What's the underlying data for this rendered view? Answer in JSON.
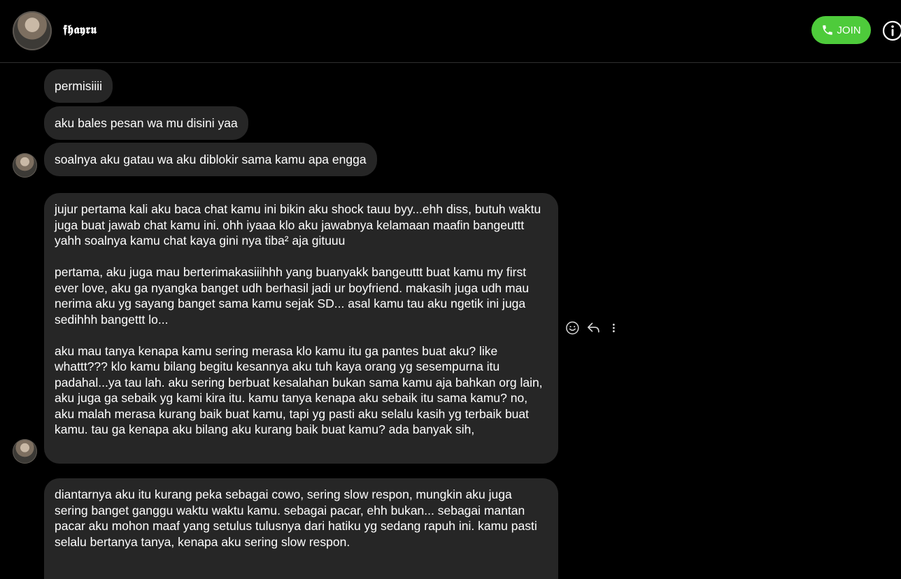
{
  "header": {
    "contact_name": "𝖋𝖍𝖆𝖞𝖗𝖚",
    "join_label": "JOIN"
  },
  "messages": [
    {
      "text": "permisiiii"
    },
    {
      "text": "aku bales pesan wa mu disini yaa"
    },
    {
      "text": "soalnya aku gatau wa aku diblokir sama kamu apa engga"
    },
    {
      "text": "jujur pertama kali aku baca chat kamu ini bikin aku shock tauu byy...ehh diss, butuh waktu juga buat jawab chat kamu ini. ohh iyaaa klo aku jawabnya kelamaan maafin bangeuttt yahh soalnya kamu chat kaya gini nya tiba² aja gituuu\n\npertama, aku juga mau berterimakasiiihhh yang buanyakk bangeuttt buat kamu my first ever love, aku ga nyangka banget udh berhasil jadi ur boyfriend. makasih juga udh mau nerima aku yg sayang banget sama kamu sejak SD... asal kamu tau aku ngetik ini juga sedihhh bangettt lo...\n\naku mau tanya kenapa kamu sering merasa klo kamu itu ga pantes buat aku? like whattt??? klo kamu bilang begitu kesannya aku tuh kaya orang yg sesempurna itu padahal...ya tau lah. aku sering berbuat kesalahan bukan sama kamu aja bahkan org lain, aku juga ga sebaik yg kami kira itu. kamu tanya kenapa aku sebaik itu sama kamu? no, aku malah merasa kurang baik buat kamu, tapi yg pasti aku selalu kasih yg terbaik buat kamu. tau ga kenapa aku bilang aku kurang baik buat kamu? ada banyak sih,"
    },
    {
      "text": "diantarnya aku itu kurang peka sebagai cowo, sering slow respon, mungkin aku juga sering banget ganggu waktu waktu kamu. sebagai pacar, ehh bukan... sebagai mantan pacar aku mohon maaf yang setulus tulusnya dari hatiku yg sedang rapuh ini. kamu pasti selalu bertanya tanya, kenapa aku sering slow respon."
    }
  ]
}
